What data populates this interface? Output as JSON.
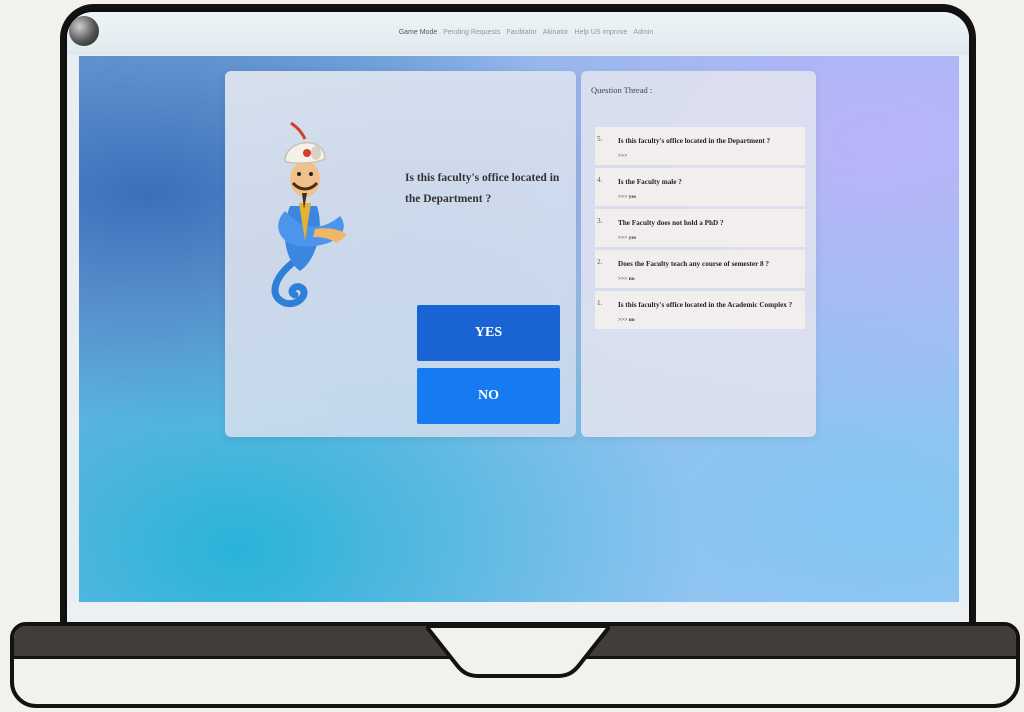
{
  "nav": {
    "links": [
      "Game Mode",
      "Pending Requests",
      "Facilitator",
      "Akinator",
      "Help US improve",
      "Admin"
    ]
  },
  "question": {
    "text": "Is this faculty's office located in the Department ?"
  },
  "buttons": {
    "yes": "YES",
    "no": "NO"
  },
  "thread": {
    "title": "Question Thread :",
    "items": [
      {
        "num": "5.",
        "text": "Is this faculty's office located in the Department ?",
        "answer": ">>>"
      },
      {
        "num": "4.",
        "text": "Is the Faculty male ?",
        "answer": ">>> yes"
      },
      {
        "num": "3.",
        "text": "The Faculty does not hold a PhD ?",
        "answer": ">>> yes"
      },
      {
        "num": "2.",
        "text": "Does the Faculty teach any course of semester 8 ?",
        "answer": ">>> no"
      },
      {
        "num": "1.",
        "text": "Is this faculty's office located in the Academic Complex ?",
        "answer": ">>> no"
      }
    ]
  },
  "colors": {
    "yes_button": "#1a63d4",
    "no_button": "#167af2"
  }
}
